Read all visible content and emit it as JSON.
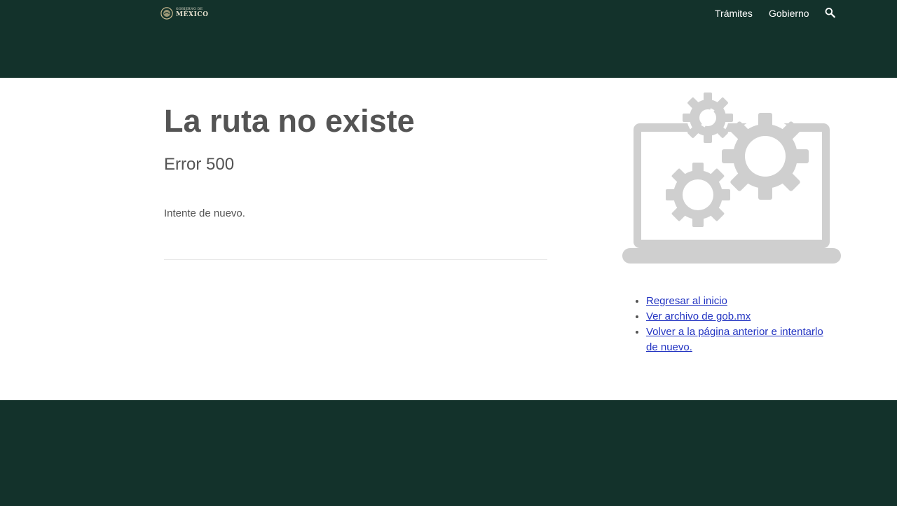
{
  "header": {
    "logo": {
      "line1": "GOBIERNO DE",
      "line2": "MÉXICO",
      "icon": "coat-of-arms-seal"
    },
    "nav": [
      {
        "label": "Trámites"
      },
      {
        "label": "Gobierno"
      }
    ],
    "search_icon": "search-icon"
  },
  "main": {
    "title": "La ruta no existe",
    "error_code": "Error 500",
    "message": "Intente de nuevo."
  },
  "sidebar": {
    "illustration_icon": "laptop-gears-icon",
    "links": [
      {
        "label": "Regresar al inicio"
      },
      {
        "label": "Ver archivo de gob.mx"
      },
      {
        "label": "Volver a la página anterior e intentarlo de nuevo."
      }
    ]
  },
  "colors": {
    "brand_dark_green": "#13322b",
    "text_gray": "#545454",
    "link_blue": "#2334c2",
    "illustration_gray": "#cfcfcf"
  }
}
